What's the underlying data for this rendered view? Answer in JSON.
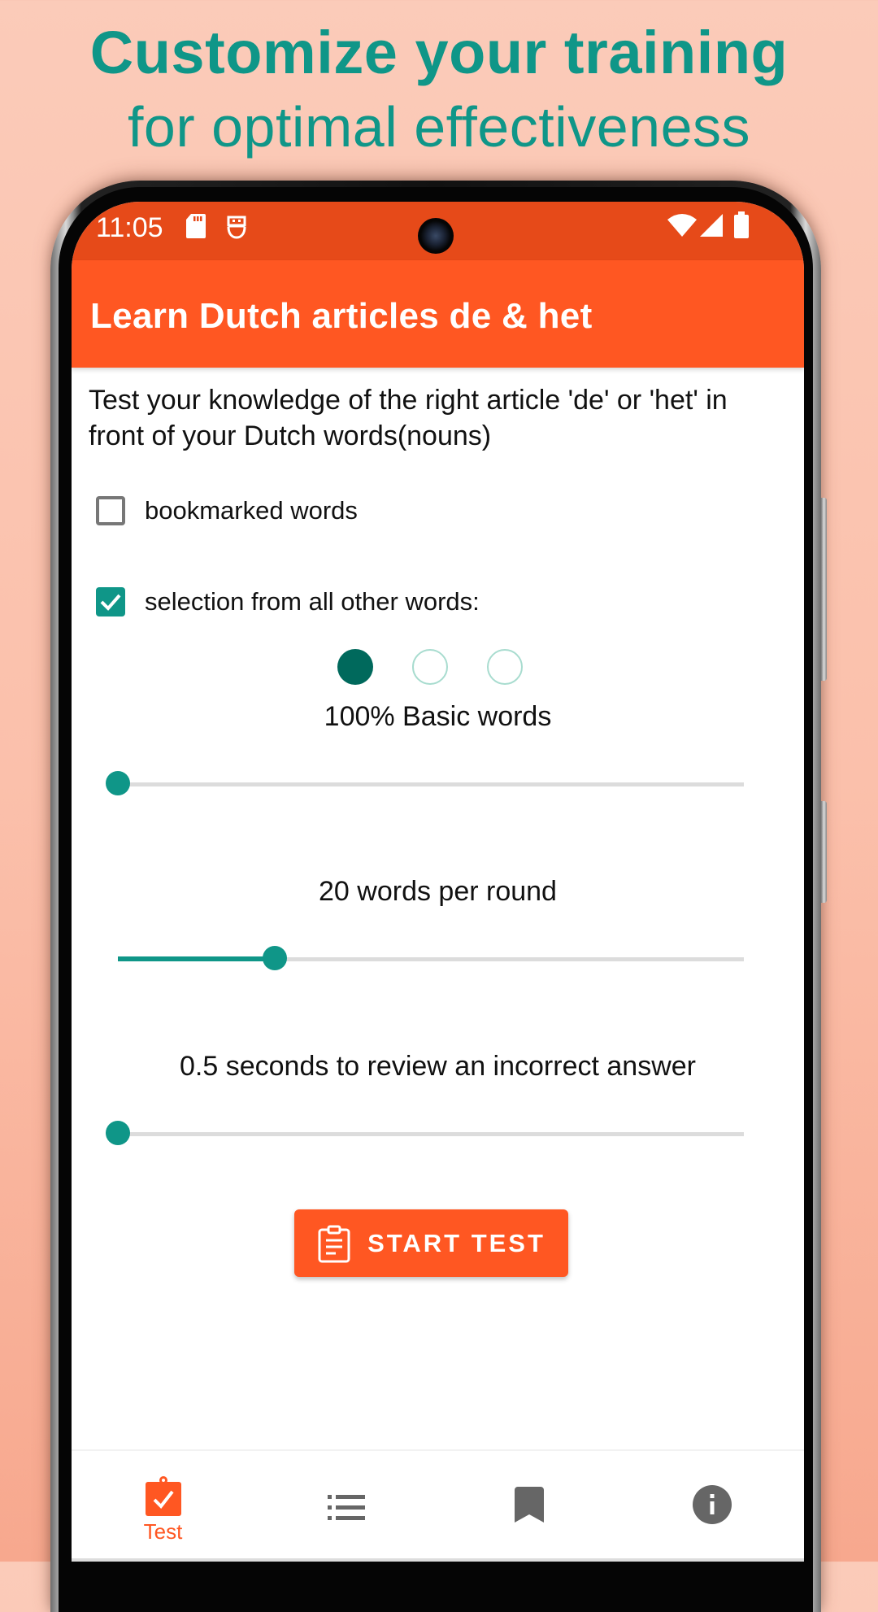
{
  "headline": {
    "line1": "Customize your training",
    "line2": "for optimal effectiveness"
  },
  "statusbar": {
    "time": "11:05",
    "left_icons": [
      "sd-card-icon",
      "app-notification-icon"
    ],
    "right_icons": [
      "wifi-icon",
      "signal-icon",
      "battery-icon"
    ]
  },
  "appbar": {
    "title": "Learn Dutch articles de & het"
  },
  "content": {
    "description": "Test your knowledge of the right article 'de' or 'het' in front of your Dutch words(nouns)",
    "checkboxes": [
      {
        "label": "bookmarked words",
        "checked": false
      },
      {
        "label": "selection from all other words:",
        "checked": true
      }
    ],
    "level_dots": {
      "count": 3,
      "selected_index": 0
    },
    "sliders": [
      {
        "caption": "100% Basic words",
        "fraction": 0.0
      },
      {
        "caption": "20 words per round",
        "fraction": 0.25
      },
      {
        "caption": "0.5 seconds to review an incorrect answer",
        "fraction": 0.0
      }
    ],
    "start_button": {
      "label": "START TEST",
      "icon": "clipboard-icon"
    }
  },
  "bottom_nav": {
    "items": [
      {
        "label": "Test",
        "icon": "clipboard-check-icon",
        "active": true
      },
      {
        "label": "",
        "icon": "list-icon",
        "active": false
      },
      {
        "label": "",
        "icon": "bookmark-icon",
        "active": false
      },
      {
        "label": "",
        "icon": "info-icon",
        "active": false
      }
    ]
  },
  "colors": {
    "primary": "#ff5722",
    "primary_dark": "#e64a19",
    "accent": "#0f9688",
    "dot_active": "#00695c",
    "headline": "#0f9688"
  }
}
